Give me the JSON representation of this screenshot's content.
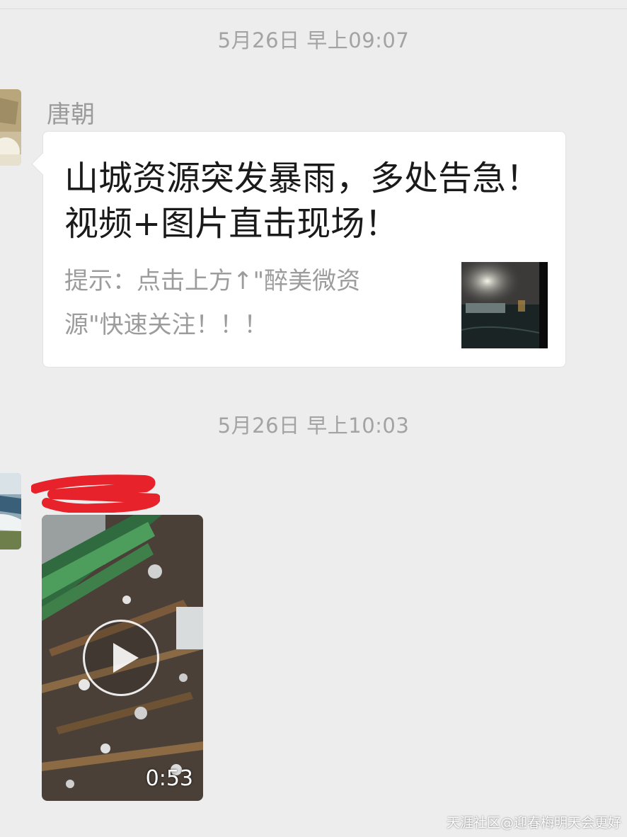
{
  "messages": [
    {
      "timestamp": "5月26日 早上09:07",
      "sender": "唐朝",
      "article": {
        "title": "山城资源突发暴雨，多处告急！视频+图片直击现场！",
        "description": "提示：点击上方↑\"醉美微资源\"快速关注！！！"
      }
    },
    {
      "timestamp": "5月26日 早上10:03",
      "video": {
        "duration": "0:53"
      }
    }
  ],
  "watermark": "天涯社区@迎春梅明天会更好",
  "icons": {
    "play": "play-icon"
  },
  "colors": {
    "background": "#ededed",
    "bubble": "#ffffff",
    "timestamp": "#a3a3a3",
    "redaction": "#e8222a"
  }
}
